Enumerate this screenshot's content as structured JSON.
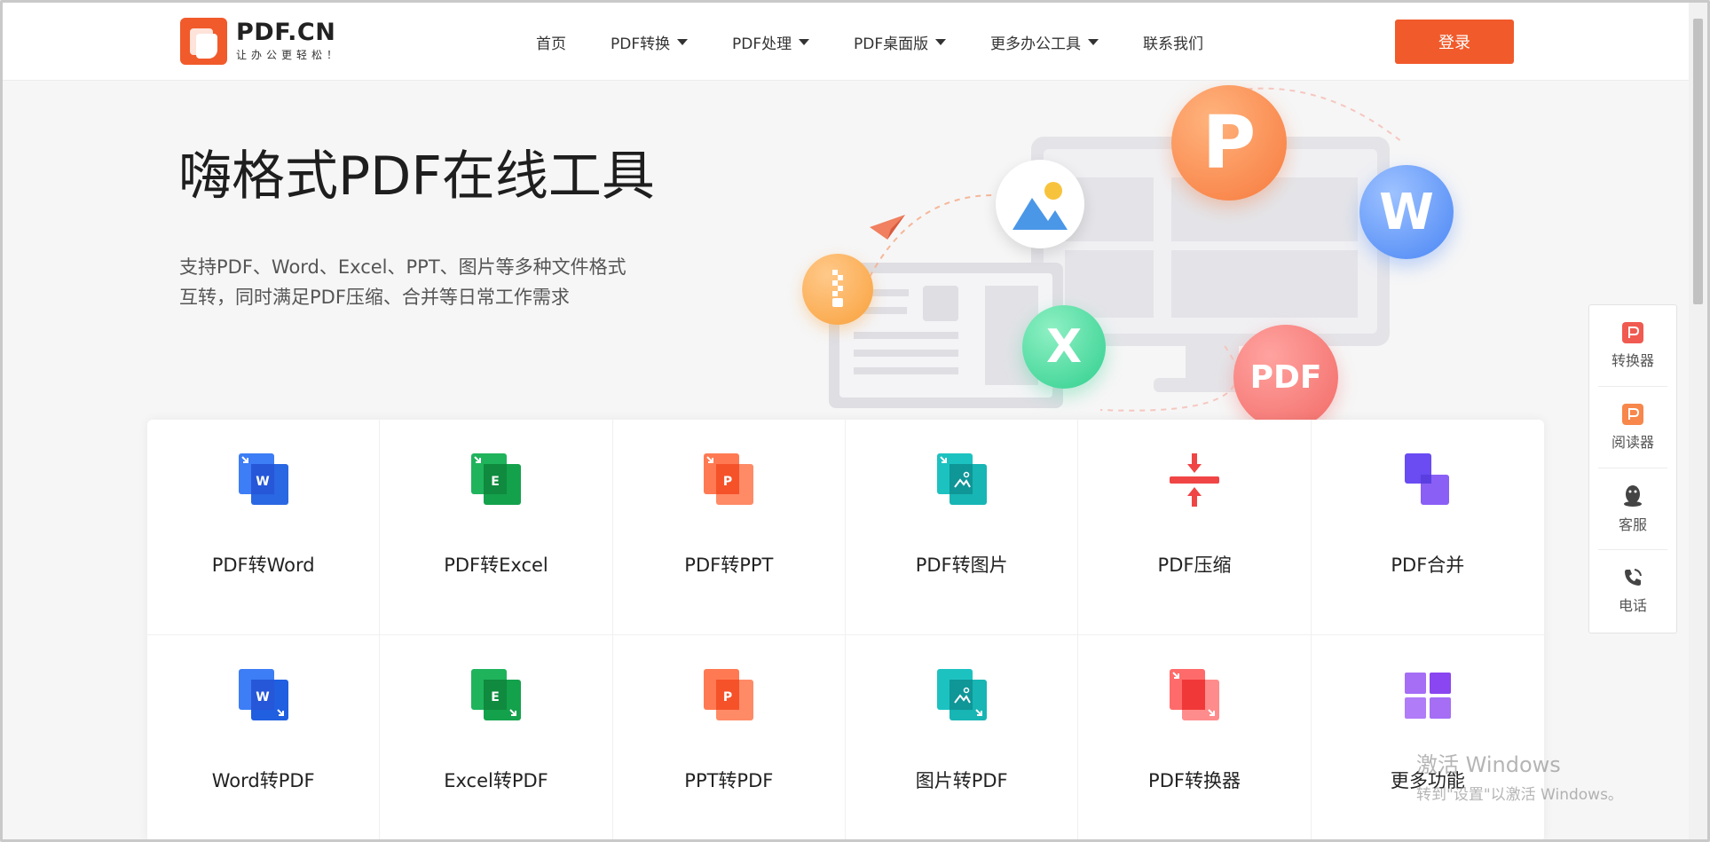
{
  "header": {
    "logo_name": "PDF.CN",
    "logo_slogan": "让办公更轻松！",
    "nav": [
      {
        "label": "首页",
        "has_dropdown": false
      },
      {
        "label": "PDF转换",
        "has_dropdown": true
      },
      {
        "label": "PDF处理",
        "has_dropdown": true
      },
      {
        "label": "PDF桌面版",
        "has_dropdown": true
      },
      {
        "label": "更多办公工具",
        "has_dropdown": true
      },
      {
        "label": "联系我们",
        "has_dropdown": false
      }
    ],
    "login_label": "登录"
  },
  "hero": {
    "title": "嗨格式PDF在线工具",
    "desc_line1": "支持PDF、Word、Excel、PPT、图片等多种文件格式",
    "desc_line2": "互转，同时满足PDF压缩、合并等日常工作需求"
  },
  "illustration": {
    "bubble_p": "P",
    "bubble_w": "W",
    "bubble_x": "X",
    "bubble_pdf": "PDF"
  },
  "tools": [
    {
      "label": "PDF转Word",
      "icon": "pdf-to-word-icon",
      "letter": "W",
      "color": "#2f6ef0"
    },
    {
      "label": "PDF转Excel",
      "icon": "pdf-to-excel-icon",
      "letter": "E",
      "color": "#1ba552"
    },
    {
      "label": "PDF转PPT",
      "icon": "pdf-to-ppt-icon",
      "letter": "P",
      "color": "#f2603a"
    },
    {
      "label": "PDF转图片",
      "icon": "pdf-to-image-icon",
      "letter": "",
      "color": "#16b3b8"
    },
    {
      "label": "PDF压缩",
      "icon": "compress-icon",
      "letter": "",
      "color": "#ef4b4b"
    },
    {
      "label": "PDF合并",
      "icon": "merge-icon",
      "letter": "",
      "color": "#7a52f4"
    },
    {
      "label": "Word转PDF",
      "icon": "word-to-pdf-icon",
      "letter": "W",
      "color": "#2f6ef0"
    },
    {
      "label": "Excel转PDF",
      "icon": "excel-to-pdf-icon",
      "letter": "E",
      "color": "#1ba552"
    },
    {
      "label": "PPT转PDF",
      "icon": "ppt-to-pdf-icon",
      "letter": "P",
      "color": "#f2603a"
    },
    {
      "label": "图片转PDF",
      "icon": "image-to-pdf-icon",
      "letter": "",
      "color": "#16b3b8"
    },
    {
      "label": "PDF转换器",
      "icon": "pdf-converter-icon",
      "letter": "",
      "color": "#ef4b4b"
    },
    {
      "label": "更多功能",
      "icon": "more-features-icon",
      "letter": "",
      "color": "#8a54f0"
    }
  ],
  "side_panel": [
    {
      "label": "转换器",
      "icon": "converter-icon"
    },
    {
      "label": "阅读器",
      "icon": "reader-icon"
    },
    {
      "label": "客服",
      "icon": "qq-icon"
    },
    {
      "label": "电话",
      "icon": "phone-icon"
    }
  ],
  "watermark": {
    "line1": "激活 Windows",
    "line2": "转到\"设置\"以激活 Windows。"
  },
  "colors": {
    "brand": "#f15a2b"
  }
}
